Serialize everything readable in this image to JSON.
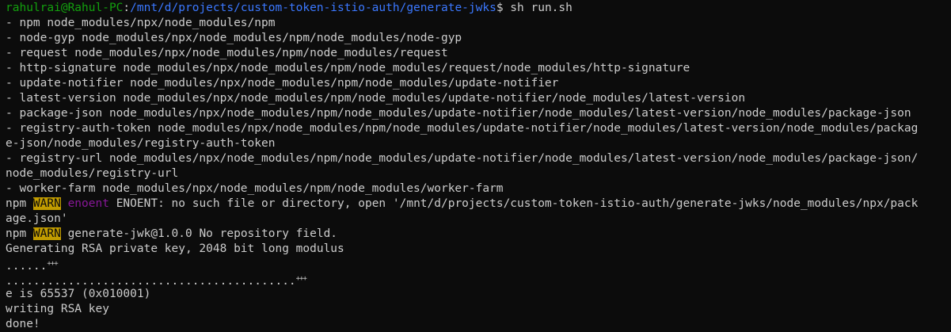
{
  "prompt": {
    "user_host": "rahulrai@Rahul-PC",
    "sep": ":",
    "path": "/mnt/d/projects/custom-token-istio-auth/generate-jwks",
    "symbol": "$ ",
    "command": "sh run.sh"
  },
  "modules": [
    "- npm node_modules/npx/node_modules/npm",
    "- node-gyp node_modules/npx/node_modules/npm/node_modules/node-gyp",
    "- request node_modules/npx/node_modules/npm/node_modules/request",
    "- http-signature node_modules/npx/node_modules/npm/node_modules/request/node_modules/http-signature",
    "- update-notifier node_modules/npx/node_modules/npm/node_modules/update-notifier",
    "- latest-version node_modules/npx/node_modules/npm/node_modules/update-notifier/node_modules/latest-version",
    "- package-json node_modules/npx/node_modules/npm/node_modules/update-notifier/node_modules/latest-version/node_modules/package-json",
    "- registry-auth-token node_modules/npx/node_modules/npm/node_modules/update-notifier/node_modules/latest-version/node_modules/packag",
    "e-json/node_modules/registry-auth-token",
    "- registry-url node_modules/npx/node_modules/npm/node_modules/update-notifier/node_modules/latest-version/node_modules/package-json/",
    "node_modules/registry-url",
    "- worker-farm node_modules/npx/node_modules/npm/node_modules/worker-farm"
  ],
  "warn1": {
    "prefix": "npm ",
    "level": "WARN",
    "code": "enoent",
    "message": " ENOENT: no such file or directory, open '/mnt/d/projects/custom-token-istio-auth/generate-jwks/node_modules/npx/pack",
    "continuation": "age.json'"
  },
  "warn2": {
    "prefix": "npm ",
    "level": "WARN",
    "message": " generate-jwk@1.0.0 No repository field."
  },
  "keygen": {
    "line1": "Generating RSA private key, 2048 bit long modulus",
    "dots1": "......",
    "plus1": "+++",
    "dots2": "..........................................",
    "plus2": "+++",
    "exponent": "e is 65537 (0x010001)",
    "writing": "writing RSA key",
    "done": "done!"
  },
  "colors": {
    "background": "#0c0c0c",
    "foreground": "#cccccc",
    "prompt_user": "#13a10e",
    "prompt_path": "#3b78ff",
    "warn_bg": "#c19c00",
    "enoent": "#881798"
  }
}
